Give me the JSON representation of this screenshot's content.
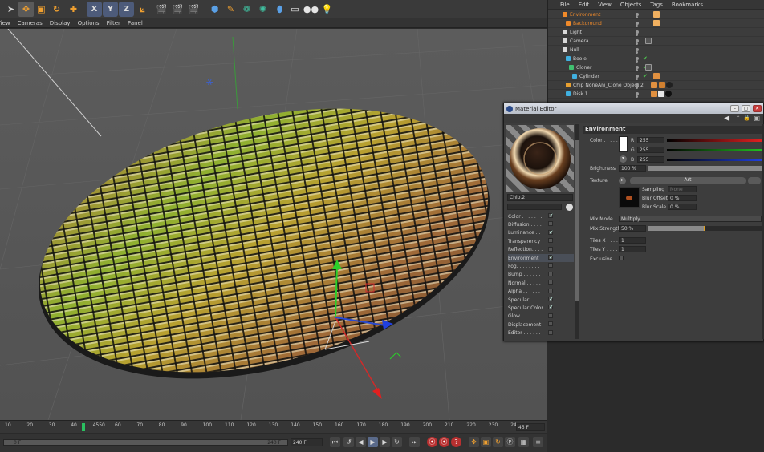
{
  "toolbar": {
    "axis_x": "X",
    "axis_y": "Y",
    "axis_z": "Z"
  },
  "viewport_menu": [
    "View",
    "Cameras",
    "Display",
    "Options",
    "Filter",
    "Panel"
  ],
  "object_manager": {
    "menu": [
      "File",
      "Edit",
      "View",
      "Objects",
      "Tags",
      "Bookmarks"
    ],
    "objects": [
      {
        "name": "Environment",
        "color": "#f08a2a"
      },
      {
        "name": "Background",
        "color": "#f08a2a"
      },
      {
        "name": "Light",
        "color": "#d0d0d0"
      },
      {
        "name": "Camera",
        "color": "#d0d0d0"
      },
      {
        "name": "Null",
        "color": "#d0d0d0"
      },
      {
        "name": "Boole",
        "color": "#d0d0d0"
      },
      {
        "name": "Cloner",
        "color": "#d0d0d0"
      },
      {
        "name": "Cylinder",
        "color": "#d0d0d0"
      },
      {
        "name": "Chip NoneAni_Clone Object 2",
        "color": "#d0d0d0"
      },
      {
        "name": "Disk.1",
        "color": "#d0d0d0"
      }
    ]
  },
  "material_editor": {
    "title": "Material Editor",
    "material_name": "Chip.2",
    "channels": [
      {
        "label": "Color . . . . . . .",
        "checked": true
      },
      {
        "label": "Diffusion . . . .",
        "checked": false
      },
      {
        "label": "Luminance . . .",
        "checked": true
      },
      {
        "label": "Transparency",
        "checked": false
      },
      {
        "label": "Reflection. . . .",
        "checked": false
      },
      {
        "label": "Environment",
        "checked": true
      },
      {
        "label": "Fog. . . . . . . .",
        "checked": false
      },
      {
        "label": "Bump . . . . . .",
        "checked": false
      },
      {
        "label": "Normal . . . . .",
        "checked": false
      },
      {
        "label": "Alpha . . . . . .",
        "checked": false
      },
      {
        "label": "Specular . . . .",
        "checked": true
      },
      {
        "label": "Specular Color",
        "checked": true
      },
      {
        "label": "Glow . . . . . .",
        "checked": false
      },
      {
        "label": "Displacement",
        "checked": false
      },
      {
        "label": "Editor . . . . . .",
        "checked": false
      }
    ],
    "section_title": "Environment",
    "color_label": "Color . . . . .",
    "r_label": "R",
    "g_label": "G",
    "b_label": "B",
    "r_value": "255",
    "g_value": "255",
    "b_value": "255",
    "brightness_label": "Brightness",
    "brightness_value": "100 %",
    "texture_label": "Texture",
    "texture_value": "Art",
    "sampling_label": "Sampling",
    "sampling_value": "None",
    "blur_offset_label": "Blur Offset",
    "blur_offset_value": "0 %",
    "blur_scale_label": "Blur Scale",
    "blur_scale_value": "0 %",
    "mix_mode_label": "Mix Mode . .",
    "mix_mode_value": "Multiply",
    "mix_strength_label": "Mix Strength",
    "mix_strength_value": "50 %",
    "mix_strength_fraction": 0.5,
    "tiles_x_label": "Tiles X . . . .",
    "tiles_x_value": "1",
    "tiles_y_label": "Tiles Y . . . .",
    "tiles_y_value": "1",
    "exclusive_label": "Exclusive . . ."
  },
  "timeline": {
    "ticks": [
      "10",
      "20",
      "30",
      "40",
      "4550",
      "60",
      "70",
      "80",
      "90",
      "100",
      "110",
      "120",
      "130",
      "140",
      "150",
      "160",
      "170",
      "180",
      "190",
      "200",
      "210",
      "220",
      "230",
      "24"
    ],
    "current_frame": "45 F",
    "start_frame": "0 F",
    "end_frame": "240 F",
    "end_field": "240 F"
  }
}
